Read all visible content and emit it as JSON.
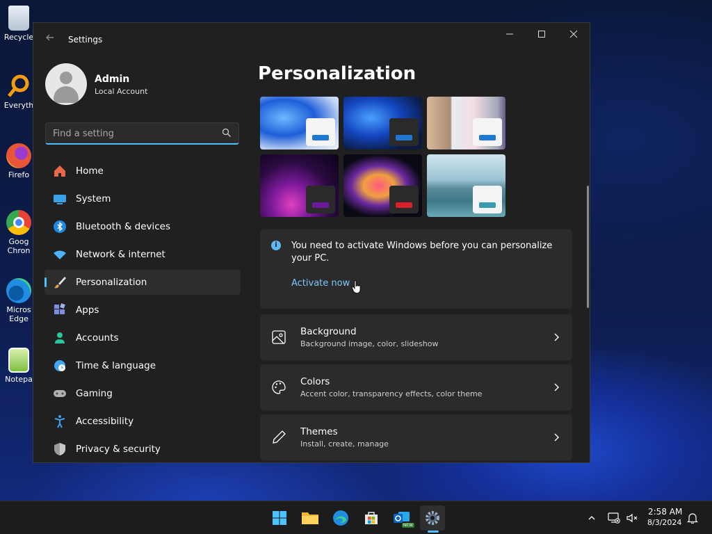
{
  "desktop": {
    "icons": [
      {
        "label": "Recycle",
        "color": "#cfd8e3"
      },
      {
        "label": "Everyth",
        "color": "#f39c12"
      },
      {
        "label": "Firefo",
        "color": "#e8563a"
      },
      {
        "label": "Goog\nChron",
        "color": "#34a853"
      },
      {
        "label": "Micros\nEdge",
        "color": "#1f8de0"
      },
      {
        "label": "Notepa",
        "color": "#7fbf3f"
      }
    ]
  },
  "window": {
    "title": "Settings",
    "controls": {
      "minimize": "—",
      "maximize": "☐",
      "close": "✕"
    }
  },
  "profile": {
    "name": "Admin",
    "account_type": "Local Account"
  },
  "search": {
    "placeholder": "Find a setting"
  },
  "nav": {
    "items": [
      {
        "label": "Home",
        "icon": "home-icon",
        "color": "#e86a4a"
      },
      {
        "label": "System",
        "icon": "system-icon",
        "color": "#3aa0e8"
      },
      {
        "label": "Bluetooth & devices",
        "icon": "bluetooth-icon",
        "color": "#1e88e5"
      },
      {
        "label": "Network & internet",
        "icon": "wifi-icon",
        "color": "#4cb4ff"
      },
      {
        "label": "Personalization",
        "icon": "brush-icon",
        "color": "#e8a060"
      },
      {
        "label": "Apps",
        "icon": "apps-icon",
        "color": "#7a8fe0"
      },
      {
        "label": "Accounts",
        "icon": "accounts-icon",
        "color": "#2ec4a0"
      },
      {
        "label": "Time & language",
        "icon": "globe-icon",
        "color": "#40a8f0"
      },
      {
        "label": "Gaming",
        "icon": "gamepad-icon",
        "color": "#b0b0b0"
      },
      {
        "label": "Accessibility",
        "icon": "accessibility-icon",
        "color": "#3aa0f0"
      },
      {
        "label": "Privacy & security",
        "icon": "shield-icon",
        "color": "#9a9a9a"
      }
    ],
    "active_index": 4
  },
  "main": {
    "title": "Personalization",
    "themes": [
      {
        "bar_color": "#1e78d4"
      },
      {
        "bar_color": "#1e78d4"
      },
      {
        "bar_color": "#1e78d4"
      },
      {
        "bar_color": "#6a1a9a"
      },
      {
        "bar_color": "#d81f2a"
      },
      {
        "bar_color": "#3a9ab0"
      }
    ],
    "activation": {
      "message": "You need to activate Windows before you can personalize your PC.",
      "link": "Activate now"
    },
    "rows": [
      {
        "title": "Background",
        "subtitle": "Background image, color, slideshow",
        "icon": "image-icon"
      },
      {
        "title": "Colors",
        "subtitle": "Accent color, transparency effects, color theme",
        "icon": "palette-icon"
      },
      {
        "title": "Themes",
        "subtitle": "Install, create, manage",
        "icon": "pen-icon"
      }
    ]
  },
  "taskbar": {
    "clock_time": "2:58 AM",
    "clock_date": "8/3/2024",
    "new_badge": "NEW"
  },
  "colors": {
    "accent": "#4cc2ff",
    "window_bg": "#202020",
    "card_bg": "#2b2b2b"
  }
}
